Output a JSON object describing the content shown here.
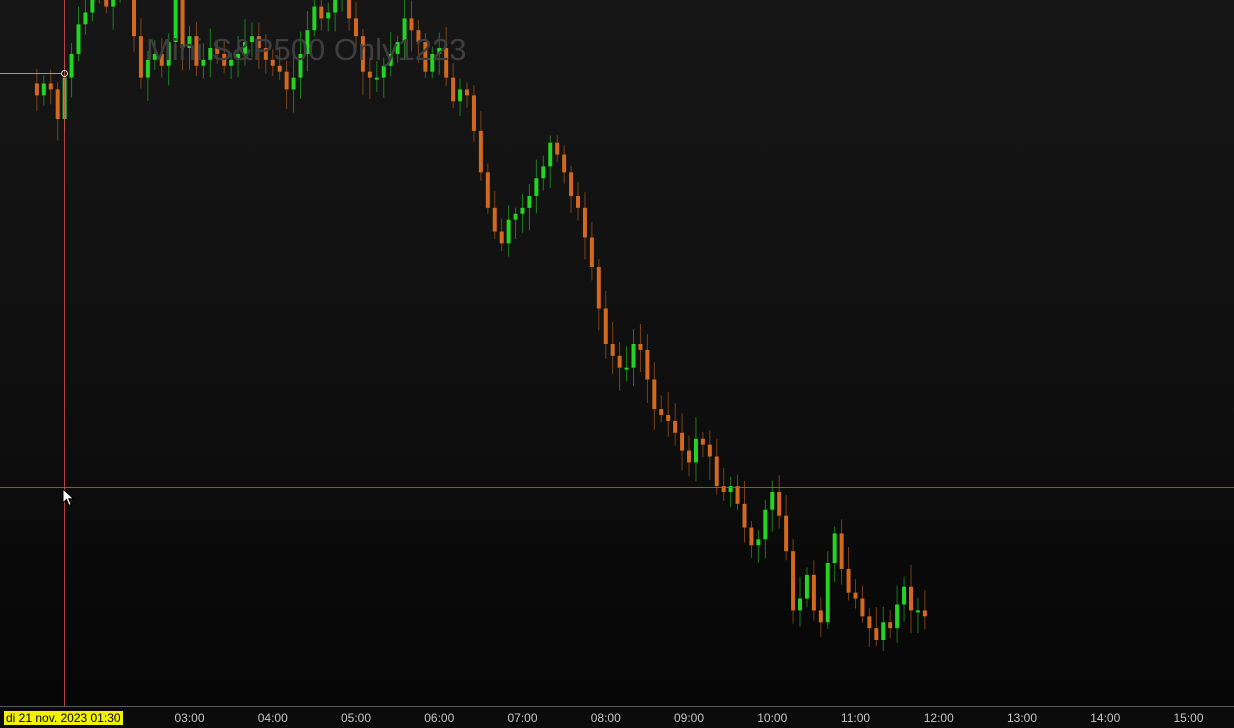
{
  "window": {
    "title": "Mini S&P500 Only1223",
    "crosshair_time_label": "di 21 nov. 2023 01:30"
  },
  "colors": {
    "up_candle": "#23d423",
    "down_candle": "#d2691e",
    "crosshair": "#d24a4a",
    "background_top": "#161616",
    "background_bottom": "#050505"
  },
  "icons": {
    "cursor": "arrow-cursor-icon"
  },
  "chart_data": {
    "type": "candlestick",
    "title": "Mini S&P500 Only1223",
    "x_ticks": [
      "03:00",
      "04:00",
      "05:00",
      "06:00",
      "07:00",
      "08:00",
      "09:00",
      "10:00",
      "11:00",
      "12:00",
      "13:00",
      "14:00",
      "15:00"
    ],
    "x_range": [
      "01:10",
      "15:35"
    ],
    "bar_interval_minutes": 5,
    "y_range_relative": [
      0,
      100
    ],
    "grid": false,
    "legend": "none",
    "series": [
      {
        "name": "Mini S&P500 Only1223",
        "time_start": "01:10",
        "close": [
          92,
          94,
          93,
          88,
          95,
          99,
          104,
          106,
          110,
          117,
          107,
          110,
          118,
          112,
          102,
          95,
          98,
          99,
          97,
          101,
          109,
          100,
          102,
          97,
          98,
          100,
          99,
          97,
          98,
          99,
          101,
          102,
          100,
          98,
          97,
          96,
          93,
          95,
          99,
          103,
          107,
          105,
          106,
          110,
          110,
          105,
          102,
          96,
          95,
          95,
          97,
          99,
          101,
          105,
          103,
          101,
          96,
          99,
          100,
          95,
          91,
          93,
          92,
          86,
          79,
          73,
          69,
          67,
          71,
          72,
          73,
          75,
          78,
          80,
          84,
          82,
          79,
          75,
          73,
          68,
          63,
          56,
          50,
          48,
          46,
          46,
          50,
          49,
          44,
          39,
          38,
          37,
          35,
          32,
          30,
          34,
          33,
          31,
          26,
          25,
          26,
          23,
          19,
          16,
          17,
          22,
          25,
          21,
          15,
          5,
          7,
          11,
          5,
          3,
          13,
          18,
          12,
          8,
          7,
          4,
          2,
          0,
          3,
          2,
          6,
          9,
          5,
          5,
          4
        ]
      }
    ]
  }
}
